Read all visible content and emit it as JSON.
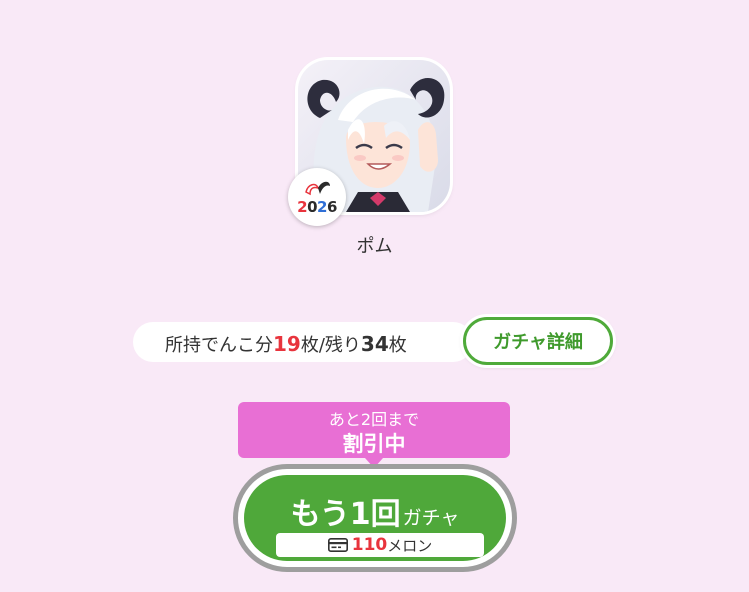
{
  "character": {
    "name": "ポム",
    "avatar_icon": "character-portrait",
    "badge": {
      "year_digits": [
        "2",
        "0",
        "2",
        "6"
      ],
      "colors": [
        "#e8343d",
        "#2b2b2b",
        "#2f6fd6",
        "#2b2b2b"
      ]
    }
  },
  "tickets": {
    "prefix": "所持でんこ分",
    "owned": "19",
    "unit1": "枚/残り",
    "remaining": "34",
    "unit2": "枚"
  },
  "detail_button": {
    "label": "ガチャ詳細"
  },
  "discount": {
    "line1": "あと2回まで",
    "line2": "割引中"
  },
  "gacha_button": {
    "main": "もう1回",
    "suffix": "ガチャ",
    "price": "110",
    "currency": "メロン",
    "currency_icon": "melon-card-icon"
  },
  "colors": {
    "background": "#f9e9f7",
    "accent_green": "#4fa83a",
    "accent_pink": "#e86fd4",
    "highlight_red": "#e8343d"
  }
}
